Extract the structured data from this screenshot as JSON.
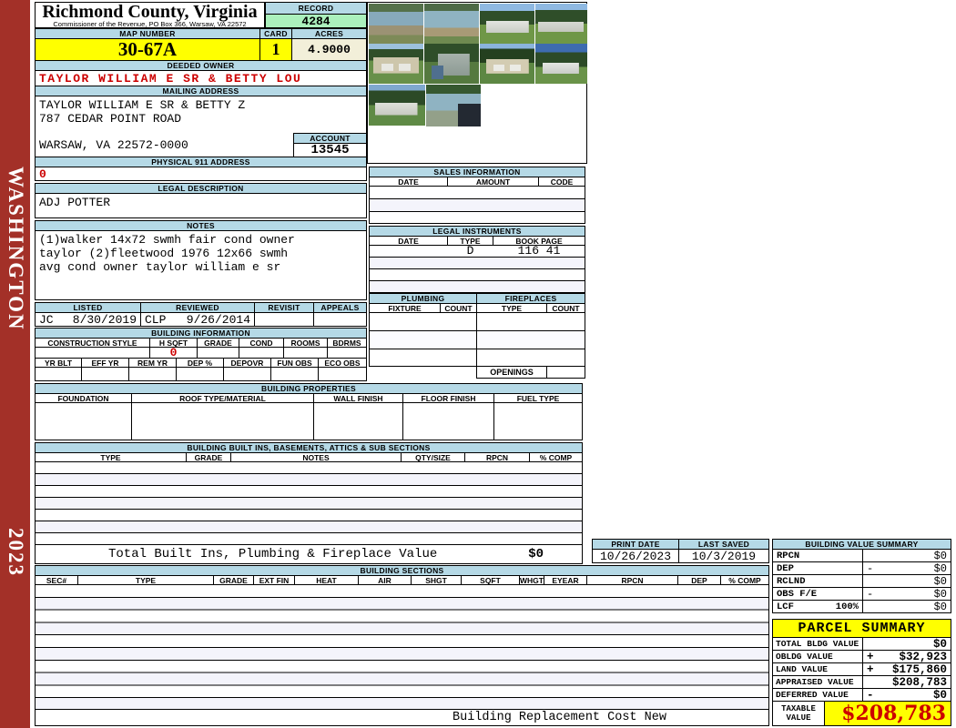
{
  "sidebar": {
    "state_label": "WASHINGTON",
    "year": "2023"
  },
  "header": {
    "county_title": "Richmond County, Virginia",
    "county_subtitle": "Commissioner of the Revenue, PO Box 366, Warsaw, VA 22572",
    "record_label": "RECORD",
    "record_value": "4284",
    "map_number_label": "MAP NUMBER",
    "map_number_value": "30-67A",
    "card_label": "CARD",
    "card_value": "1",
    "acres_label": "ACRES",
    "acres_value": "4.9000"
  },
  "owner": {
    "deeded_owner_label": "DEEDED OWNER",
    "deeded_owner_value": "TAYLOR WILLIAM E SR & BETTY LOU",
    "mailing_address_label": "MAILING ADDRESS",
    "mailing_line1": "TAYLOR WILLIAM E SR & BETTY Z",
    "mailing_line2": "787 CEDAR POINT ROAD",
    "mailing_line3": "WARSAW, VA 22572-0000",
    "account_label": "ACCOUNT",
    "account_value": "13545",
    "physical_911_label": "PHYSICAL 911 ADDRESS",
    "physical_911_value": "0",
    "legal_description_label": "LEGAL DESCRIPTION",
    "legal_description_value": "ADJ POTTER",
    "notes_label": "NOTES",
    "notes_line1": "(1)walker 14x72 swmh fair cond owner",
    "notes_line2": "taylor (2)fleetwood 1976 12x66 swmh",
    "notes_line3": "avg cond owner taylor william e sr"
  },
  "review": {
    "listed_label": "LISTED",
    "reviewed_label": "REVIEWED",
    "revisit_label": "REVISIT",
    "appeals_label": "APPEALS",
    "listed_by": "JC",
    "listed_date": "8/30/2019",
    "reviewed_by": "CLP",
    "reviewed_date": "9/26/2014"
  },
  "building_information": {
    "label": "BUILDING INFORMATION",
    "headers_row1": [
      "CONSTRUCTION STYLE",
      "H SQFT",
      "GRADE",
      "COND",
      "ROOMS",
      "BDRMS"
    ],
    "h_sqft_value": "0",
    "headers_row2": [
      "YR BLT",
      "EFF YR",
      "REM YR",
      "DEP %",
      "DEPOVR",
      "FUN OBS",
      "ECO OBS"
    ]
  },
  "building_properties": {
    "label": "BUILDING PROPERTIES",
    "headers": [
      "FOUNDATION",
      "ROOF TYPE/MATERIAL",
      "WALL FINISH",
      "FLOOR FINISH",
      "FUEL TYPE"
    ]
  },
  "built_ins": {
    "label": "BUILDING BUILT INS, BASEMENTS, ATTICS & SUB SECTIONS",
    "headers": [
      "TYPE",
      "GRADE",
      "NOTES",
      "QTY/SIZE",
      "RPCN",
      "% COMP"
    ],
    "total_label": "Total Built Ins, Plumbing & Fireplace Value",
    "total_value": "$0"
  },
  "sales": {
    "label": "SALES INFORMATION",
    "headers": [
      "DATE",
      "AMOUNT",
      "CODE"
    ]
  },
  "legal_instruments": {
    "label": "LEGAL INSTRUMENTS",
    "headers": [
      "DATE",
      "TYPE",
      "BOOK PAGE"
    ],
    "row1_type": "D",
    "row1_book_page": "116 41"
  },
  "plumbing": {
    "label": "PLUMBING",
    "headers": [
      "FIXTURE",
      "COUNT"
    ]
  },
  "fireplaces": {
    "label": "FIREPLACES",
    "headers": [
      "TYPE",
      "COUNT"
    ],
    "openings_label": "OPENINGS"
  },
  "dates": {
    "print_date_label": "PRINT DATE",
    "print_date_value": "10/26/2023",
    "last_saved_label": "LAST SAVED",
    "last_saved_value": "10/3/2019"
  },
  "building_value_summary": {
    "label": "BUILDING VALUE SUMMARY",
    "rows": [
      {
        "label": "RPCN",
        "sub": "",
        "op": "",
        "value": "$0"
      },
      {
        "label": "DEP",
        "sub": "",
        "op": "-",
        "value": "$0"
      },
      {
        "label": "RCLND",
        "sub": "",
        "op": "",
        "value": "$0"
      },
      {
        "label": "OBS F/E",
        "sub": "",
        "op": "-",
        "value": "$0"
      },
      {
        "label": "LCF",
        "sub": "100%",
        "op": "",
        "value": "$0"
      }
    ]
  },
  "building_sections": {
    "label": "BUILDING SECTIONS",
    "headers": [
      "SEC#",
      "TYPE",
      "GRADE",
      "EXT FIN",
      "HEAT",
      "AIR",
      "SHGT",
      "SQFT",
      "WHGT",
      "EYEAR",
      "RPCN",
      "DEP",
      "% COMP"
    ],
    "footer": "Building Replacement Cost New"
  },
  "parcel_summary": {
    "label": "PARCEL SUMMARY",
    "rows": [
      {
        "label": "TOTAL BLDG VALUE",
        "op": "",
        "value": "$0"
      },
      {
        "label": "OBLDG VALUE",
        "op": "+",
        "value": "$32,923"
      },
      {
        "label": "LAND VALUE",
        "op": "+",
        "value": "$175,860"
      },
      {
        "label": "APPRAISED VALUE",
        "op": "",
        "value": "$208,783"
      },
      {
        "label": "DEFERRED VALUE",
        "op": "-",
        "value": "$0"
      }
    ],
    "taxable_label": "TAXABLE VALUE",
    "taxable_value": "$208,783"
  },
  "photos": [
    "waterfront boat ramp",
    "waterfront dock",
    "singlewide mobile home",
    "mobile home rear view",
    "two-bay garage",
    "storage shed with boat",
    "two-bay garage front",
    "mobile home in trees",
    "mobile home side view",
    "dock with pickup truck"
  ],
  "colors": {
    "header_blue": "#b5d9e6",
    "highlight_yellow": "#ffff00",
    "record_green": "#abf0bc",
    "acres_cream": "#f2efd9",
    "sidebar_maroon": "#a33028",
    "value_red": "#cc0000"
  }
}
